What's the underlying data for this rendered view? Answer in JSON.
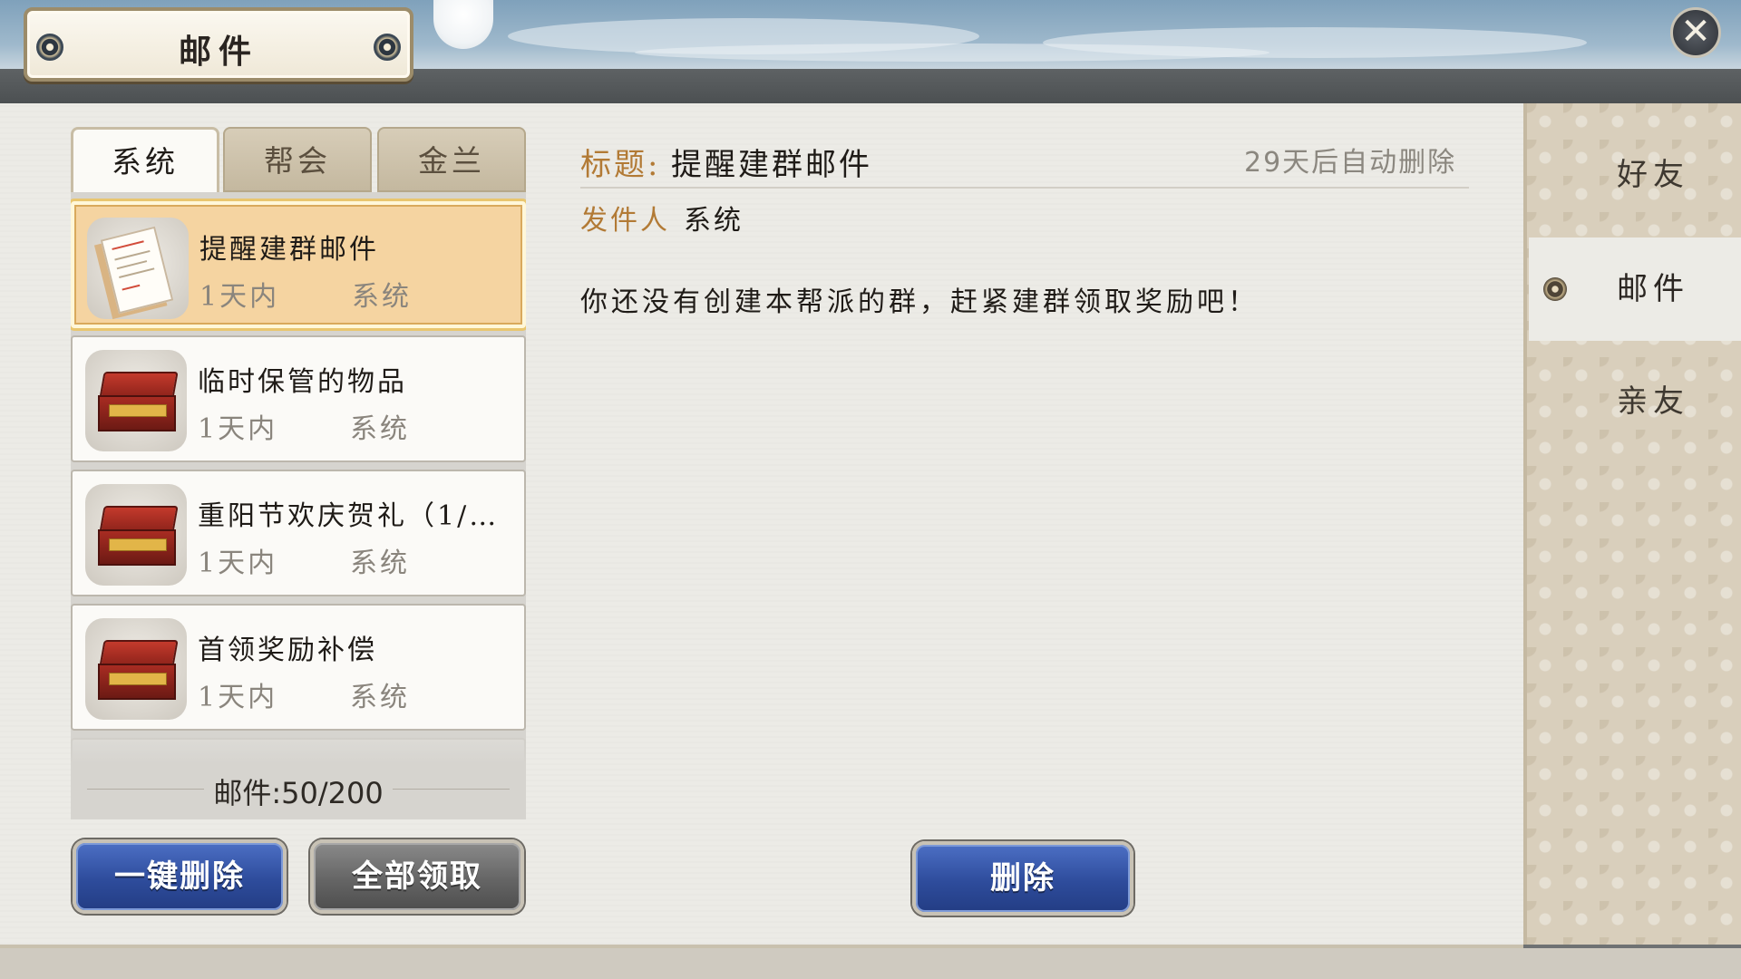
{
  "window": {
    "title": "邮件",
    "close_icon": "close-icon"
  },
  "tabs": [
    {
      "label": "系统",
      "active": true
    },
    {
      "label": "帮会",
      "active": false
    },
    {
      "label": "金兰",
      "active": false
    }
  ],
  "mail_list": [
    {
      "title": "提醒建群邮件",
      "time": "1天内",
      "sender": "系统",
      "icon": "scroll-icon",
      "selected": true
    },
    {
      "title": "临时保管的物品",
      "time": "1天内",
      "sender": "系统",
      "icon": "treasure-chest-icon",
      "selected": false
    },
    {
      "title": "重阳节欢庆贺礼（1/…",
      "time": "1天内",
      "sender": "系统",
      "icon": "treasure-chest-icon",
      "selected": false
    },
    {
      "title": "首领奖励补偿",
      "time": "1天内",
      "sender": "系统",
      "icon": "treasure-chest-icon",
      "selected": false
    }
  ],
  "mail_count": "邮件:50/200",
  "buttons": {
    "delete_all": "一键删除",
    "claim_all": "全部领取",
    "delete": "删除"
  },
  "detail": {
    "title_label": "标题:",
    "title_value": "提醒建群邮件",
    "auto_delete": "29天后自动删除",
    "sender_label": "发件人",
    "sender_value": "系统",
    "body": "你还没有创建本帮派的群，赶紧建群领取奖励吧！"
  },
  "side_tabs": [
    {
      "label": "好友",
      "active": false
    },
    {
      "label": "邮件",
      "active": true
    },
    {
      "label": "亲友",
      "active": false
    }
  ],
  "colors": {
    "selected_item": "#f5d4a1",
    "label_gold": "#b27a35",
    "button_blue": "#2e4c9c",
    "button_gray": "#656565"
  }
}
